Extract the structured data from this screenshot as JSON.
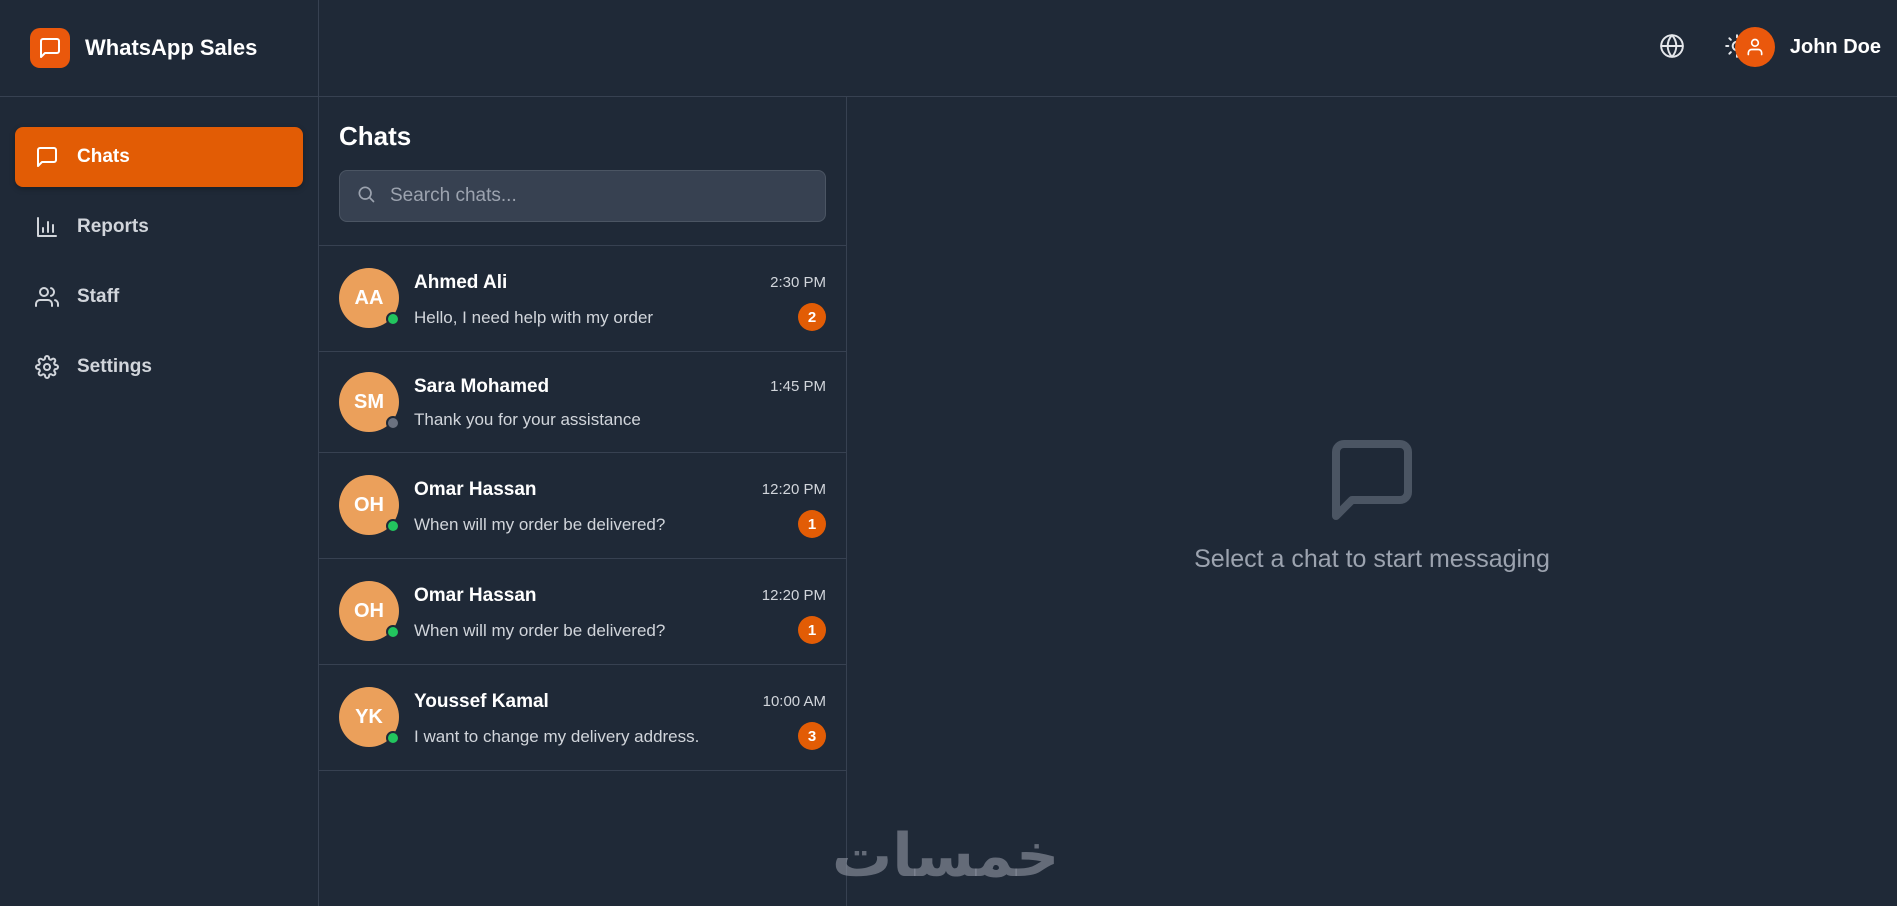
{
  "brand": {
    "title": "WhatsApp Sales",
    "icon": "message-square-icon",
    "accent": "#ea580c"
  },
  "sidebar": {
    "items": [
      {
        "label": "Chats",
        "icon": "message-square-icon",
        "active": true
      },
      {
        "label": "Reports",
        "icon": "bar-chart-icon",
        "active": false
      },
      {
        "label": "Staff",
        "icon": "users-icon",
        "active": false
      },
      {
        "label": "Settings",
        "icon": "gear-icon",
        "active": false
      }
    ]
  },
  "header": {
    "language_icon": "globe-icon",
    "theme_icon": "sun-icon",
    "user": {
      "name": "John Doe",
      "icon": "user-icon"
    }
  },
  "chatlist": {
    "title": "Chats",
    "search": {
      "placeholder": "Search chats...",
      "value": ""
    },
    "chats": [
      {
        "initials": "AA",
        "name": "Ahmed Ali",
        "message": "Hello, I need help with my order",
        "time": "2:30 PM",
        "unread": "2",
        "online": true
      },
      {
        "initials": "SM",
        "name": "Sara Mohamed",
        "message": "Thank you for your assistance",
        "time": "1:45 PM",
        "unread": "",
        "online": false
      },
      {
        "initials": "OH",
        "name": "Omar Hassan",
        "message": "When will my order be delivered?",
        "time": "12:20 PM",
        "unread": "1",
        "online": true
      },
      {
        "initials": "OH",
        "name": "Omar Hassan",
        "message": "When will my order be delivered?",
        "time": "12:20 PM",
        "unread": "1",
        "online": true
      },
      {
        "initials": "YK",
        "name": "Youssef Kamal",
        "message": "I want to change my delivery address.",
        "time": "10:00 AM",
        "unread": "3",
        "online": true
      }
    ]
  },
  "main": {
    "empty_icon": "message-square-icon",
    "empty_text": "Select a chat to start messaging"
  },
  "watermark": {
    "text": "خمسات"
  },
  "colors": {
    "background": "#1f2937",
    "accent": "#e25c05",
    "avatar": "#eba05b",
    "online": "#22c55e",
    "offline": "#6b7280"
  }
}
